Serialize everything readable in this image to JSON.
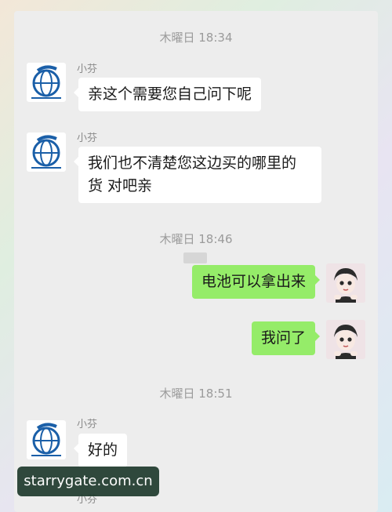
{
  "chat": {
    "times": [
      "木曜日 18:34",
      "木曜日 18:46",
      "木曜日 18:51"
    ],
    "sender_name": "小芬",
    "messages": [
      {
        "from": "other",
        "text": "亲这个需要您自己问下呢"
      },
      {
        "from": "other",
        "lines": [
          "我们也不清楚您这边买的哪里的",
          "货 对吧亲"
        ]
      },
      {
        "from": "self",
        "text": "电池可以拿出来"
      },
      {
        "from": "self",
        "text": "我问了"
      },
      {
        "from": "other",
        "text": "好的"
      }
    ]
  },
  "watermark": "starrygate.com.cn",
  "colors": {
    "self_bubble": "#95ec69",
    "other_bubble": "#ffffff",
    "chat_bg": "#ededed",
    "logo_blue": "#1a5fa8"
  },
  "icons": [
    "shop-logo-avatar",
    "girl-avatar"
  ]
}
